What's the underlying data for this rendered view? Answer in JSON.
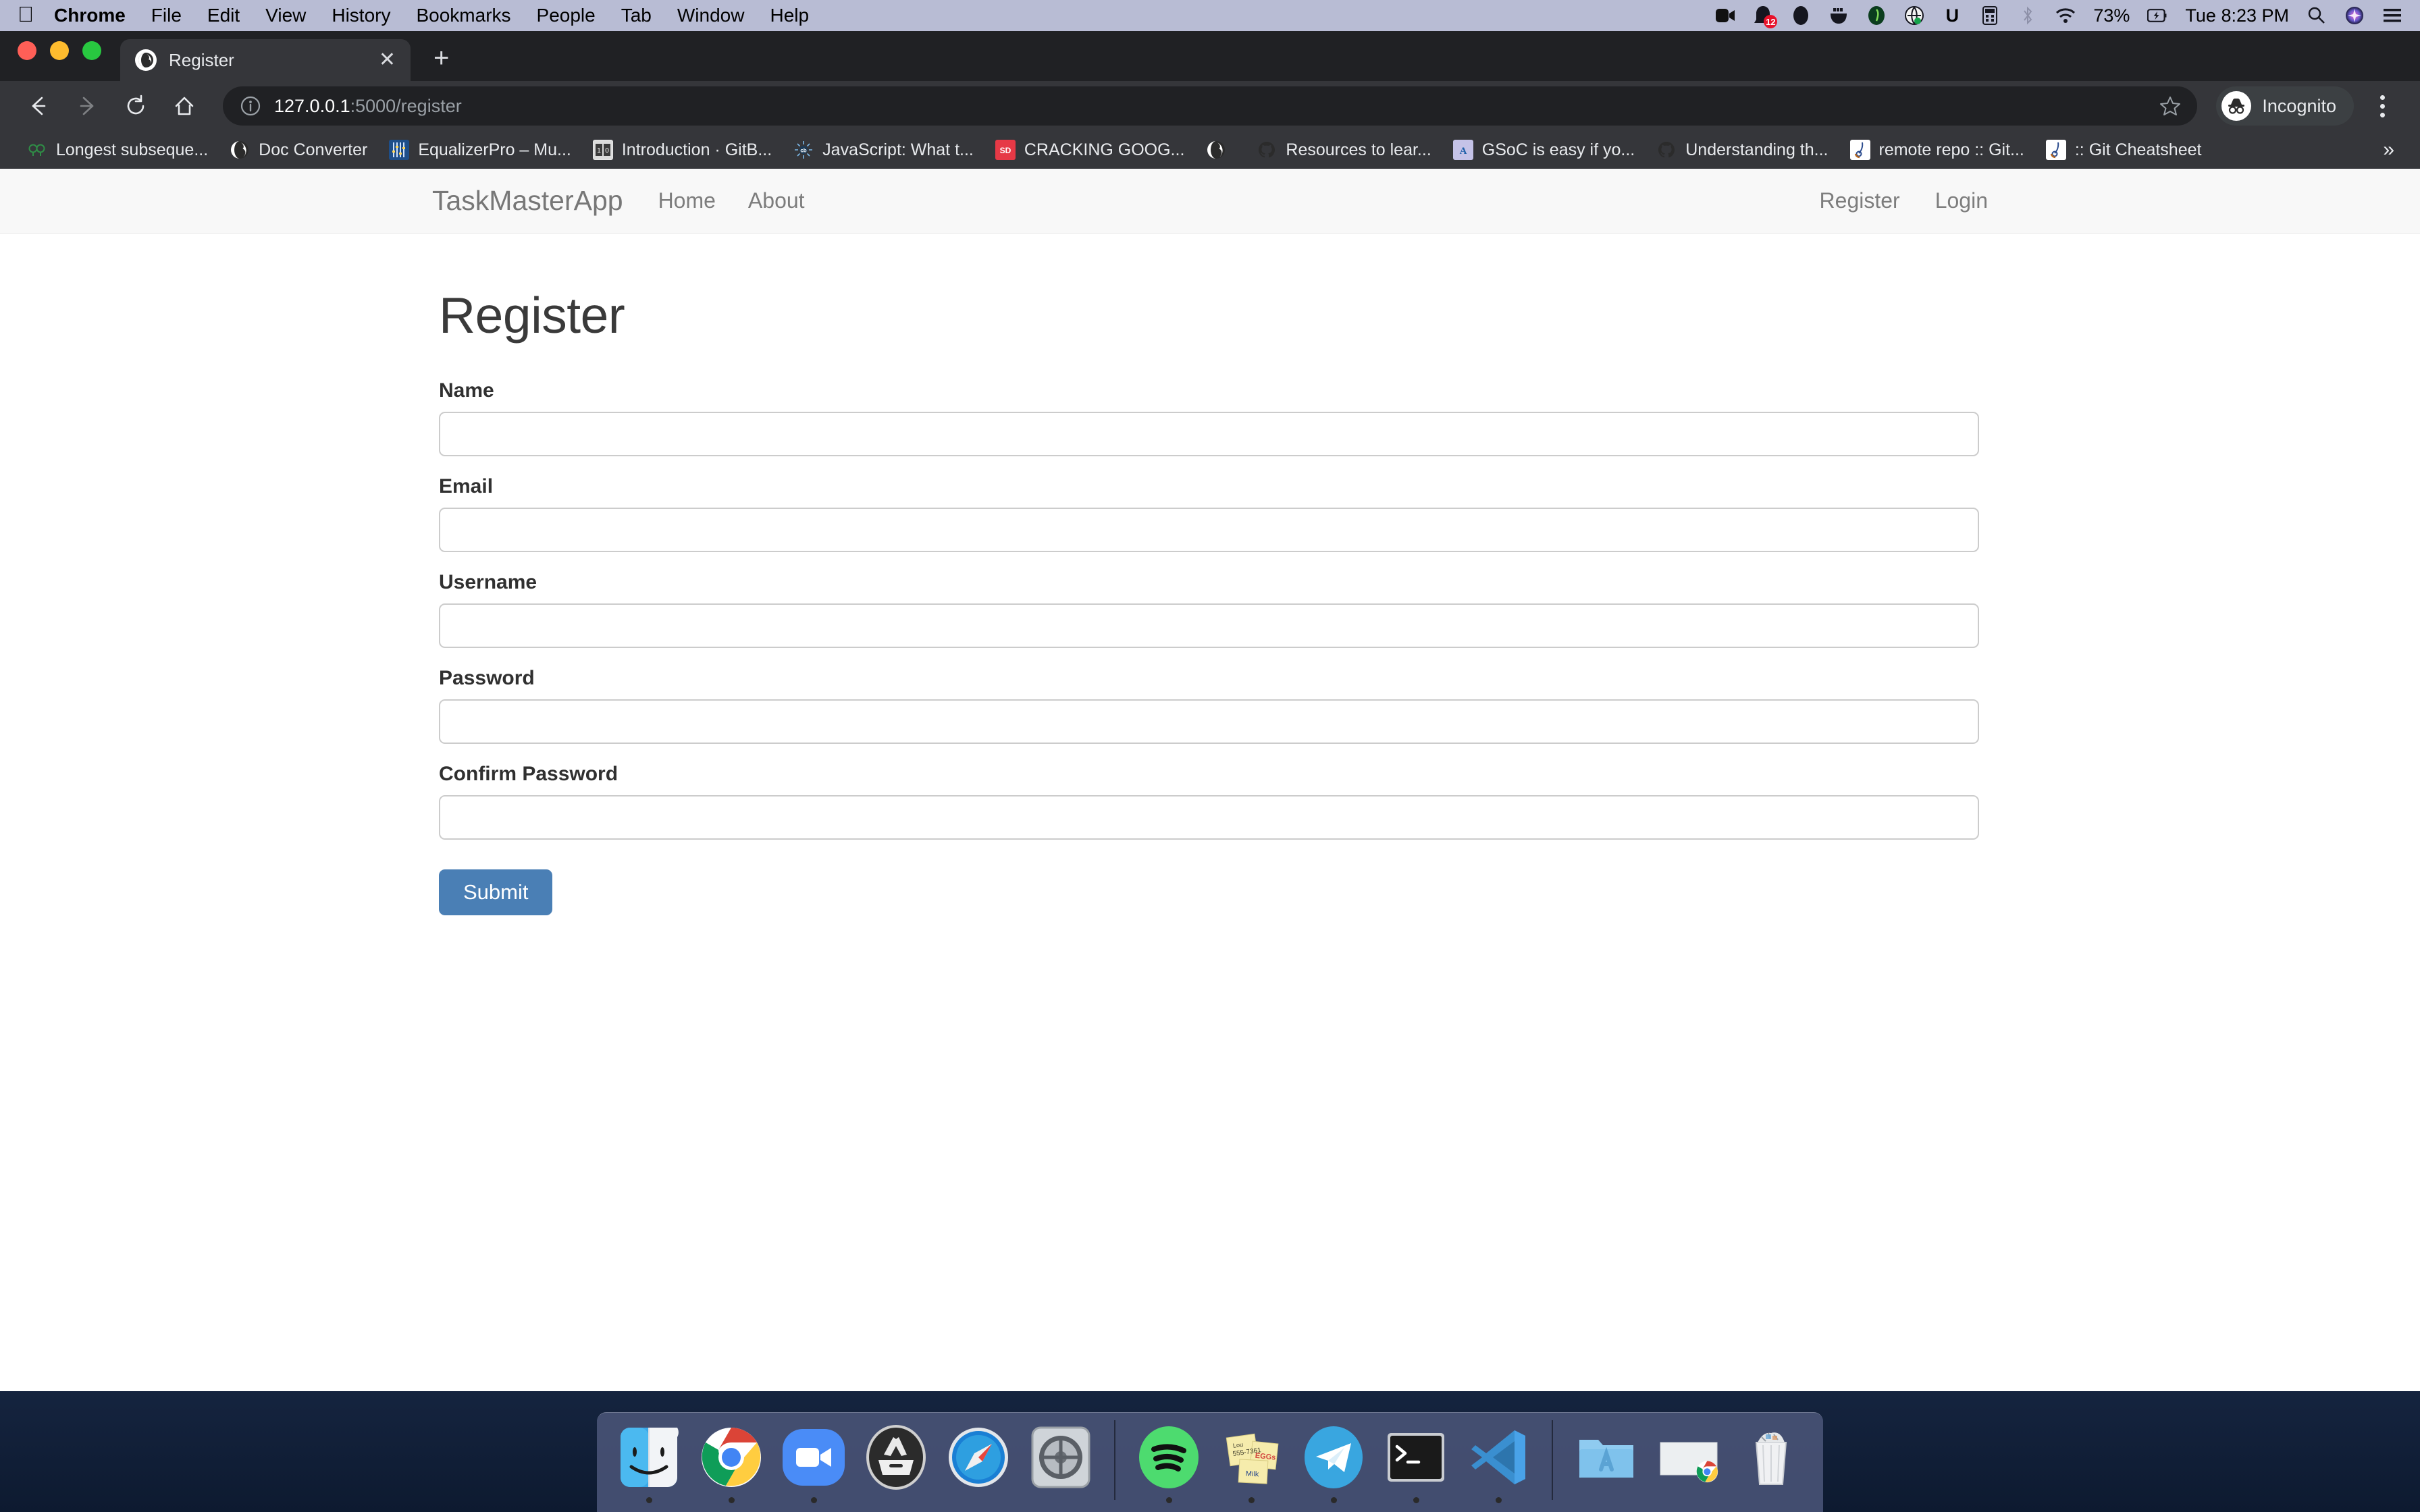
{
  "menubar": {
    "apple_icon": "apple-logo-icon",
    "items": [
      {
        "label": "Chrome",
        "bold": true
      },
      {
        "label": "File",
        "bold": false
      },
      {
        "label": "Edit",
        "bold": false
      },
      {
        "label": "View",
        "bold": false
      },
      {
        "label": "History",
        "bold": false
      },
      {
        "label": "Bookmarks",
        "bold": false
      },
      {
        "label": "People",
        "bold": false
      },
      {
        "label": "Tab",
        "bold": false
      },
      {
        "label": "Window",
        "bold": false
      },
      {
        "label": "Help",
        "bold": false
      }
    ],
    "tray": {
      "icons": [
        "zoom-camera-icon",
        "notification-bell-icon",
        "dropbox-icon",
        "docker-whale-icon",
        "evernote-icon",
        "grammarly-icon",
        "unicode-u-icon",
        "calculator-icon",
        "bluetooth-icon",
        "wifi-icon"
      ],
      "notification_count": "12",
      "battery_percent": "73%",
      "battery_icon": "battery-charging-icon",
      "clock": "Tue 8:23 PM",
      "search_icon": "spotlight-search-icon",
      "siri_icon": "siri-icon",
      "control_center_icon": "control-center-icon"
    }
  },
  "browser": {
    "tab": {
      "title": "Register",
      "favicon": "globe-favicon",
      "close_icon": "close-icon"
    },
    "new_tab_label": "+",
    "toolbar": {
      "back_icon": "back-arrow-icon",
      "forward_icon": "forward-arrow-icon",
      "reload_icon": "reload-icon",
      "home_icon": "home-icon",
      "info_icon": "page-info-icon",
      "url_host": "127.0.0.1",
      "url_path": ":5000/register",
      "star_icon": "bookmark-star-icon",
      "profile_label": "Incognito",
      "profile_icon": "incognito-icon",
      "menu_icon": "three-dot-menu-icon"
    },
    "bookmarks": [
      {
        "label": "Longest subseque...",
        "icon": "gfg-icon"
      },
      {
        "label": "Doc Converter",
        "icon": "globe-icon"
      },
      {
        "label": "EqualizerPro – Mu...",
        "icon": "equalizer-icon"
      },
      {
        "label": "Introduction · GitB...",
        "icon": "gitbook-icon"
      },
      {
        "label": "JavaScript: What t...",
        "icon": "codeburst-icon"
      },
      {
        "label": "CRACKING GOOG...",
        "icon": "slideshare-icon"
      },
      {
        "label": "",
        "icon": "globe-icon"
      },
      {
        "label": "Resources to lear...",
        "icon": "github-icon"
      },
      {
        "label": "GSoC is easy if yo...",
        "icon": "medium-a-icon"
      },
      {
        "label": "Understanding th...",
        "icon": "github-icon"
      },
      {
        "label": "remote repo :: Git...",
        "icon": "git-tower-icon"
      },
      {
        "label": ":: Git Cheatsheet",
        "icon": "git-tower-icon"
      }
    ],
    "bookmarks_overflow": "»"
  },
  "page": {
    "navbar": {
      "brand": "TaskMasterApp",
      "left_links": [
        "Home",
        "About"
      ],
      "right_links": [
        "Register",
        "Login"
      ]
    },
    "title": "Register",
    "form": {
      "fields": [
        {
          "label": "Name",
          "value": "",
          "placeholder": "",
          "type": "text",
          "name": "name"
        },
        {
          "label": "Email",
          "value": "",
          "placeholder": "",
          "type": "text",
          "name": "email"
        },
        {
          "label": "Username",
          "value": "",
          "placeholder": "",
          "type": "text",
          "name": "username"
        },
        {
          "label": "Password",
          "value": "",
          "placeholder": "",
          "type": "password",
          "name": "password"
        },
        {
          "label": "Confirm Password",
          "value": "",
          "placeholder": "",
          "type": "password",
          "name": "confirm-password"
        }
      ],
      "submit_label": "Submit",
      "submit_color": "#4a7fb5"
    }
  },
  "dock": {
    "items": [
      {
        "name": "finder",
        "running": true
      },
      {
        "name": "chrome",
        "running": true
      },
      {
        "name": "zoom",
        "running": true
      },
      {
        "name": "app-store-dark",
        "running": false
      },
      {
        "name": "safari",
        "running": false
      },
      {
        "name": "system-preferences",
        "running": false
      },
      {
        "name": "separator",
        "running": false
      },
      {
        "name": "spotify",
        "running": true
      },
      {
        "name": "stickies",
        "running": true
      },
      {
        "name": "telegram",
        "running": true
      },
      {
        "name": "terminal",
        "running": true
      },
      {
        "name": "vscode",
        "running": true
      },
      {
        "name": "separator",
        "running": false
      },
      {
        "name": "applications-folder",
        "running": false
      },
      {
        "name": "minimized-window",
        "running": false
      },
      {
        "name": "trash",
        "running": false
      }
    ]
  }
}
